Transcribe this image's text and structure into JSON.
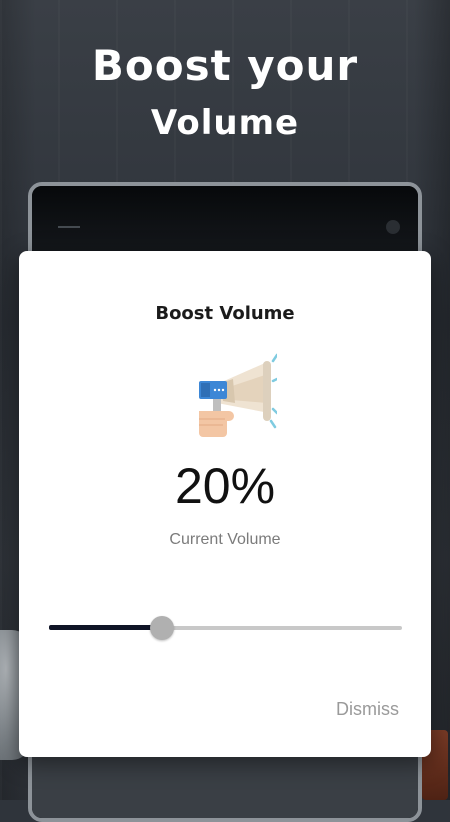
{
  "headline": {
    "line1": "Boost your",
    "line2": "Volume"
  },
  "dialog": {
    "title": "Boost Volume",
    "icon": "megaphone-icon",
    "volume_display": "20%",
    "caption": "Current Volume",
    "slider": {
      "value_fraction": 0.32
    },
    "dismiss_label": "Dismiss"
  },
  "colors": {
    "slider_fill": "#0f1426",
    "slider_track": "#c8c8c8",
    "thumb": "#b0b0b0",
    "dismiss_text": "#9a9a9a"
  }
}
